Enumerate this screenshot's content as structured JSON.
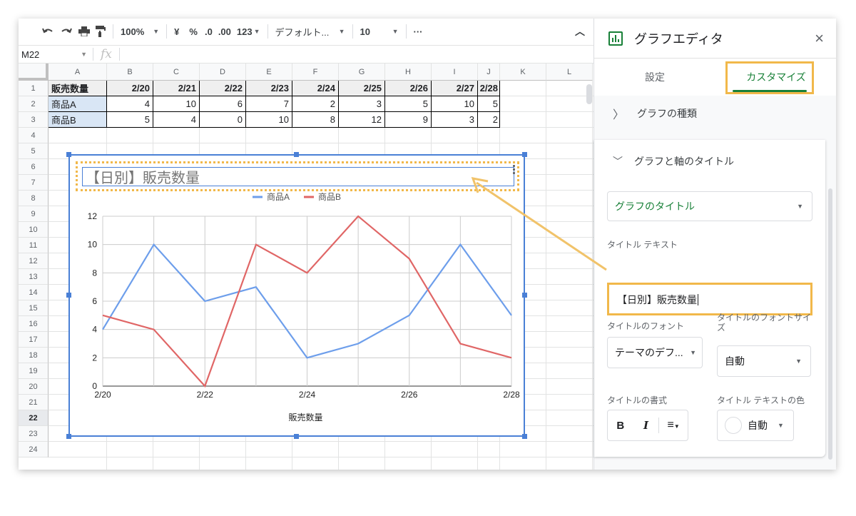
{
  "toolbar": {
    "zoom": "100%",
    "currency": "¥",
    "percent": "%",
    "dec_dec": ".0",
    "dec_inc": ".00",
    "format": "123",
    "font": "デフォルト...",
    "size": "10",
    "more": "···"
  },
  "formula": {
    "cell_ref": "M22",
    "fx": "fx"
  },
  "columns": [
    "A",
    "B",
    "C",
    "D",
    "E",
    "F",
    "G",
    "H",
    "I",
    "J",
    "K",
    "L"
  ],
  "rows": [
    "1",
    "2",
    "3",
    "4",
    "5",
    "6",
    "7",
    "8",
    "9",
    "10",
    "11",
    "12",
    "13",
    "14",
    "15",
    "16",
    "17",
    "18",
    "19",
    "20",
    "21",
    "22",
    "23",
    "24"
  ],
  "sheet": {
    "header": [
      "販売数量",
      "2/20",
      "2/21",
      "2/22",
      "2/23",
      "2/24",
      "2/25",
      "2/26",
      "2/27",
      "2/28"
    ],
    "row_a": [
      "商品A",
      "4",
      "10",
      "6",
      "7",
      "2",
      "3",
      "5",
      "10",
      "5"
    ],
    "row_b": [
      "商品B",
      "5",
      "4",
      "0",
      "10",
      "8",
      "12",
      "9",
      "3",
      "2"
    ]
  },
  "chart_title": "【日別】販売数量",
  "chart_data": {
    "type": "line",
    "title": "【日別】販売数量",
    "xlabel": "販売数量",
    "ylabel": "",
    "categories": [
      "2/20",
      "2/21",
      "2/22",
      "2/23",
      "2/24",
      "2/25",
      "2/26",
      "2/27",
      "2/28"
    ],
    "x_tick_labels": [
      "2/20",
      "2/22",
      "2/24",
      "2/26",
      "2/28"
    ],
    "y_tick_labels": [
      "0",
      "2",
      "4",
      "6",
      "8",
      "10",
      "12"
    ],
    "ylim": [
      0,
      12
    ],
    "grid": true,
    "legend": "top",
    "series": [
      {
        "name": "商品A",
        "color": "#6d9eeb",
        "values": [
          4,
          10,
          6,
          7,
          2,
          3,
          5,
          10,
          5
        ]
      },
      {
        "name": "商品B",
        "color": "#e06666",
        "values": [
          5,
          4,
          0,
          10,
          8,
          12,
          9,
          3,
          2
        ]
      }
    ]
  },
  "panel": {
    "title": "グラフエディタ",
    "close": "×",
    "tab_setup": "設定",
    "tab_customize": "カスタマイズ",
    "section_chart_type": "グラフの種類",
    "section_titles": "グラフと軸のタイトル",
    "title_type_select": "グラフのタイトル",
    "title_text_label": "タイトル テキスト",
    "title_text_value": "【日別】販売数量",
    "font_label": "タイトルのフォント",
    "font_value": "テーマのデフ...",
    "font_size_label": "タイトルのフォントサイズ",
    "font_size_value": "自動",
    "format_label": "タイトルの書式",
    "color_label": "タイトル テキストの色",
    "color_value": "自動",
    "bold": "B",
    "italic": "I"
  },
  "colors": {
    "accent": "#188038",
    "highlight": "#f1b84a",
    "selection": "#4a80d6"
  }
}
